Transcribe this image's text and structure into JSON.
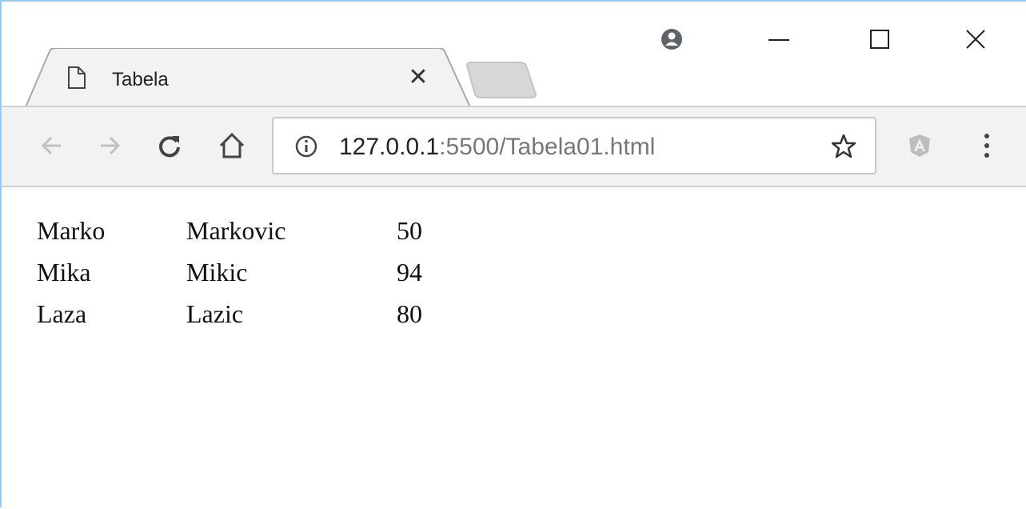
{
  "browser": {
    "tab": {
      "title": "Tabela",
      "close_glyph": "✕",
      "icon": "page-icon"
    },
    "new_tab_icon": "new-tab-icon",
    "window_controls": {
      "account_icon": "account-icon",
      "minimize_icon": "minimize-icon",
      "maximize_icon": "maximize-icon",
      "close_icon": "close-icon"
    },
    "toolbar": {
      "back_icon": "back-arrow-icon",
      "forward_icon": "forward-arrow-icon",
      "reload_icon": "reload-icon",
      "home_icon": "home-icon",
      "url_host": "127.0.0.1",
      "url_rest": ":5500/Tabela01.html",
      "info_icon": "info-icon",
      "bookmark_icon": "star-icon",
      "extension_icon": "angular-extension-icon",
      "menu_icon": "kebab-menu-icon"
    }
  },
  "page": {
    "table": {
      "rows": [
        [
          "Marko",
          "Markovic",
          "50"
        ],
        [
          "Mika",
          "Mikic",
          "94"
        ],
        [
          "Laza",
          "Lazic",
          "80"
        ]
      ]
    }
  },
  "colors": {
    "toolbar_bg": "#f2f2f2",
    "window_border": "#9cc8ec",
    "tab_outline": "#a8a8a8"
  }
}
